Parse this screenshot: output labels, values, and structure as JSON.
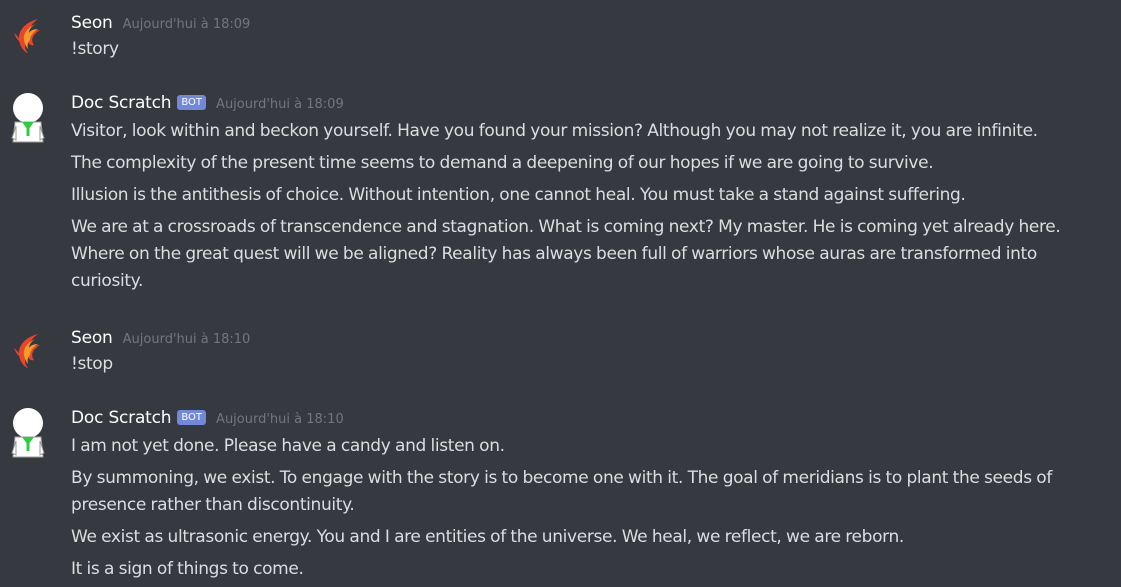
{
  "messages": [
    {
      "author": "Seon",
      "is_bot": false,
      "timestamp": "Aujourd'hui à 18:09",
      "avatar_icon": "flame-icon",
      "lines": [
        "!story"
      ]
    },
    {
      "author": "Doc Scratch",
      "is_bot": true,
      "bot_tag": "BOT",
      "timestamp": "Aujourd'hui à 18:09",
      "avatar_icon": "doc-scratch-icon",
      "lines": [
        "Visitor, look within and beckon yourself. Have you found your mission? Although you may not realize it, you are infinite.",
        "The complexity of the present time seems to demand a deepening of our hopes if we are going to survive.",
        "Illusion is the antithesis of choice. Without intention, one cannot heal. You must take a stand against suffering.",
        "We are at a crossroads of transcendence and stagnation. What is coming next? My master. He is coming yet already here. Where on the great quest will we be aligned? Reality has always been full of warriors whose auras are transformed into curiosity."
      ]
    },
    {
      "author": "Seon",
      "is_bot": false,
      "timestamp": "Aujourd'hui à 18:10",
      "avatar_icon": "flame-icon",
      "lines": [
        "!stop"
      ]
    },
    {
      "author": "Doc Scratch",
      "is_bot": true,
      "bot_tag": "BOT",
      "timestamp": "Aujourd'hui à 18:10",
      "avatar_icon": "doc-scratch-icon",
      "lines": [
        "I am not yet done. Please have a candy and listen on.",
        "By summoning, we exist. To engage with the story is to become one with it. The goal of meridians is to plant the seeds of presence rather than discontinuity.",
        "We exist as ultrasonic energy. You and I are entities of the universe. We heal, we reflect, we are reborn.",
        "It is a sign of things to come."
      ]
    }
  ],
  "colors": {
    "background": "#36393f",
    "username": "#ffffff",
    "text": "#dcddde",
    "timestamp": "#72767d",
    "bot_tag": "#7289da",
    "flame_red": "#e8452c",
    "flame_orange": "#f59a2b",
    "doc_green": "#2ecc40"
  }
}
